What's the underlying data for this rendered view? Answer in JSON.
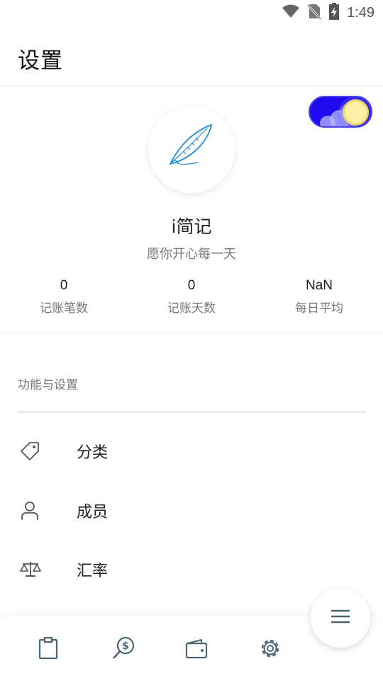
{
  "status_bar": {
    "time": "1:49",
    "icons": [
      "wifi-icon",
      "no-sim-icon",
      "battery-charging-icon"
    ]
  },
  "app_bar": {
    "title": "设置"
  },
  "profile": {
    "avatar_icon": "feather-icon",
    "app_name": "i简记",
    "slogan": "愿你开心每一天",
    "theme_toggle": {
      "mode": "night",
      "accent": "#1d0cf0",
      "knob_color": "#fbf0a5"
    },
    "stats": [
      {
        "value": "0",
        "label": "记账笔数"
      },
      {
        "value": "0",
        "label": "记账天数"
      },
      {
        "value": "NaN",
        "label": "每日平均"
      }
    ]
  },
  "settings": {
    "section_title": "功能与设置",
    "items": [
      {
        "label": "分类",
        "icon": "tag-icon"
      },
      {
        "label": "成员",
        "icon": "person-icon"
      },
      {
        "label": "汇率",
        "icon": "scale-icon"
      }
    ]
  },
  "bottom_nav": {
    "items": [
      {
        "icon": "clipboard-icon"
      },
      {
        "icon": "search-dollar-icon"
      },
      {
        "icon": "wallet-icon"
      },
      {
        "icon": "gear-icon"
      }
    ],
    "fab_icon": "menu-icon",
    "icon_color": "#4a6472"
  }
}
